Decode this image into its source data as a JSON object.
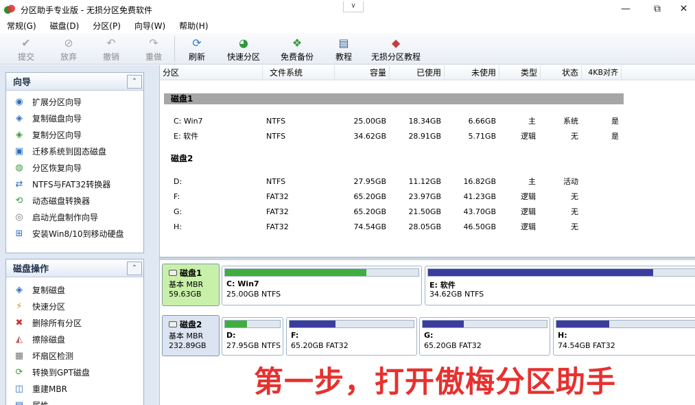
{
  "window": {
    "title": "分区助手专业版 - 无损分区免费软件",
    "dropdown_glyph": "∨",
    "minimize": "—",
    "maximize": "⧉",
    "close": "✕"
  },
  "menu": [
    {
      "label": "常规(G)"
    },
    {
      "label": "磁盘(D)"
    },
    {
      "label": "分区(P)"
    },
    {
      "label": "向导(W)"
    },
    {
      "label": "帮助(H)"
    }
  ],
  "toolbar": {
    "submit": "提交",
    "discard": "放弃",
    "undo": "撤销",
    "redo": "重做",
    "refresh": "刷新",
    "quick_partition": "快速分区",
    "free_backup": "免费备份",
    "tutorial": "教程",
    "lossless_tutorial": "无损分区教程"
  },
  "wizard_panel": {
    "title": "向导",
    "collapse": "⌃",
    "items": [
      {
        "label": "扩展分区向导"
      },
      {
        "label": "复制磁盘向导"
      },
      {
        "label": "复制分区向导"
      },
      {
        "label": "迁移系统到固态磁盘"
      },
      {
        "label": "分区恢复向导"
      },
      {
        "label": "NTFS与FAT32转换器"
      },
      {
        "label": "动态磁盘转换器"
      },
      {
        "label": "启动光盘制作向导"
      },
      {
        "label": "安装Win8/10到移动硬盘"
      }
    ]
  },
  "disk_ops_panel": {
    "title": "磁盘操作",
    "collapse": "⌃",
    "items": [
      {
        "label": "复制磁盘"
      },
      {
        "label": "快速分区"
      },
      {
        "label": "删除所有分区"
      },
      {
        "label": "擦除磁盘"
      },
      {
        "label": "坏扇区检测"
      },
      {
        "label": "转换到GPT磁盘"
      },
      {
        "label": "重建MBR"
      },
      {
        "label": "属性"
      }
    ]
  },
  "table": {
    "columns": [
      "分区",
      "文件系统",
      "容量",
      "已使用",
      "未使用",
      "类型",
      "状态",
      "4KB对齐"
    ],
    "disks": [
      {
        "name": "磁盘1",
        "rows": [
          {
            "partition": "C: Win7",
            "fs": "NTFS",
            "capacity": "25.00GB",
            "used": "18.34GB",
            "free": "6.66GB",
            "type": "主",
            "status": "系统",
            "align": "是"
          },
          {
            "partition": "E: 软件",
            "fs": "NTFS",
            "capacity": "34.62GB",
            "used": "28.91GB",
            "free": "5.71GB",
            "type": "逻辑",
            "status": "无",
            "align": "是"
          }
        ]
      },
      {
        "name": "磁盘2",
        "rows": [
          {
            "partition": "D:",
            "fs": "NTFS",
            "capacity": "27.95GB",
            "used": "11.12GB",
            "free": "16.82GB",
            "type": "主",
            "status": "活动",
            "align": ""
          },
          {
            "partition": "F:",
            "fs": "FAT32",
            "capacity": "65.20GB",
            "used": "23.97GB",
            "free": "41.23GB",
            "type": "逻辑",
            "status": "无",
            "align": ""
          },
          {
            "partition": "G:",
            "fs": "FAT32",
            "capacity": "65.20GB",
            "used": "21.50GB",
            "free": "43.70GB",
            "type": "逻辑",
            "status": "无",
            "align": ""
          },
          {
            "partition": "H:",
            "fs": "FAT32",
            "capacity": "74.54GB",
            "used": "28.05GB",
            "free": "46.50GB",
            "type": "逻辑",
            "status": "无",
            "align": ""
          }
        ]
      }
    ]
  },
  "diskmap": {
    "disk1": {
      "name": "磁盘1",
      "type": "基本 MBR",
      "size": "59.63GB",
      "parts": [
        {
          "name": "C: Win7",
          "info": "25.00GB NTFS",
          "used_fraction": 0.73,
          "color": "#3fae3f"
        },
        {
          "name": "E: 软件",
          "info": "34.62GB NTFS",
          "used_fraction": 0.84,
          "color": "#3c3c9e"
        }
      ]
    },
    "disk2": {
      "name": "磁盘2",
      "type": "基本 MBR",
      "size": "232.89GB",
      "parts": [
        {
          "name": "D:",
          "info": "27.95GB NTFS",
          "used_fraction": 0.4,
          "color": "#3fae3f"
        },
        {
          "name": "F:",
          "info": "65.20GB FAT32",
          "used_fraction": 0.37,
          "color": "#3c3c9e"
        },
        {
          "name": "G:",
          "info": "65.20GB FAT32",
          "used_fraction": 0.33,
          "color": "#3c3c9e"
        },
        {
          "name": "H:",
          "info": "74.54GB FAT32",
          "used_fraction": 0.38,
          "color": "#3c3c9e"
        }
      ]
    }
  },
  "caption": "第一步，打开傲梅分区助手",
  "colors": {
    "selected_disk_bg": "#c9f0a8",
    "caption_red": "#e6312f",
    "disk_header_gray": "#a6a6a6"
  }
}
